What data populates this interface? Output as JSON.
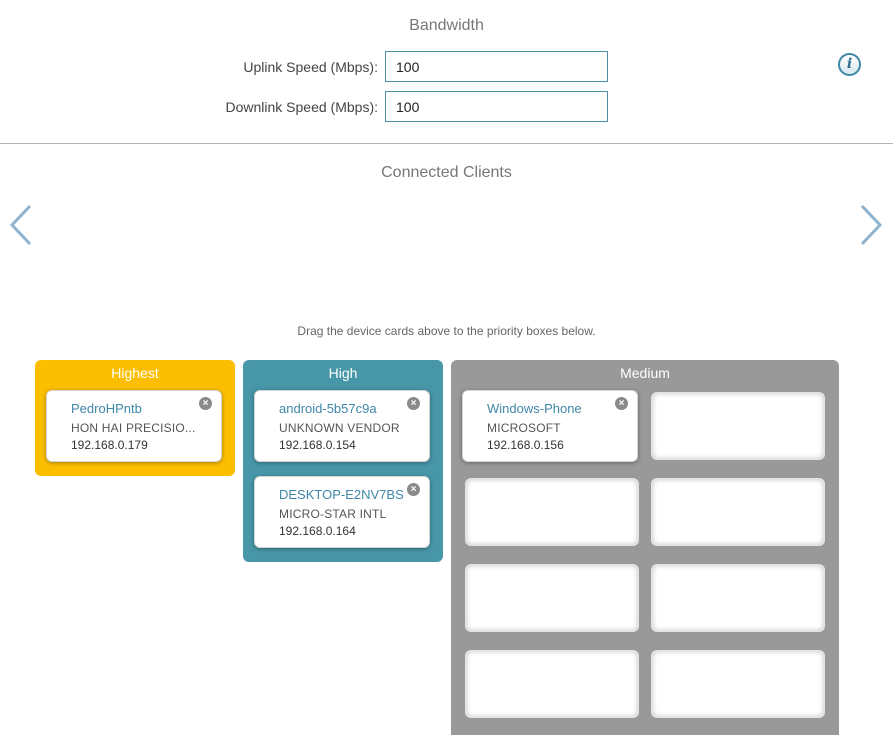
{
  "bandwidth": {
    "title": "Bandwidth",
    "uplink_label": "Uplink Speed (Mbps):",
    "uplink_value": "100",
    "downlink_label": "Downlink Speed (Mbps):",
    "downlink_value": "100"
  },
  "clients": {
    "title": "Connected Clients",
    "hint": "Drag the device cards above to the priority boxes below."
  },
  "icons": {
    "info": "info-icon",
    "prev": "chevron-left-icon",
    "next": "chevron-right-icon",
    "remove": "close-circle-icon"
  },
  "colors": {
    "highest": "#fcbf00",
    "high": "#4797a9",
    "medium": "#999999",
    "accent": "#3f87a8"
  },
  "priorities": {
    "highest": {
      "label": "Highest",
      "devices": [
        {
          "name": "PedroHPntb",
          "vendor": "HON HAI PRECISIO...",
          "ip": "192.168.0.179"
        }
      ]
    },
    "high": {
      "label": "High",
      "devices": [
        {
          "name": "android-5b57c9a",
          "vendor": "UNKNOWN VENDOR",
          "ip": "192.168.0.154"
        },
        {
          "name": "DESKTOP-E2NV7BS",
          "vendor": "MICRO-STAR INTL",
          "ip": "192.168.0.164"
        }
      ]
    },
    "medium": {
      "label": "Medium",
      "devices": [
        {
          "name": "Windows-Phone",
          "vendor": "MICROSOFT",
          "ip": "192.168.0.156"
        }
      ]
    }
  }
}
